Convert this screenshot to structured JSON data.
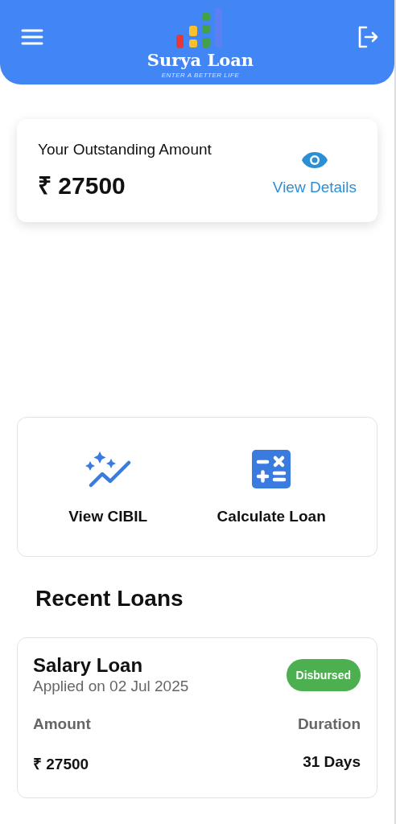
{
  "header": {
    "brand": "Surya Loan",
    "tagline": "ENTER A BETTER LIFE"
  },
  "outstanding": {
    "label": "Your Outstanding Amount",
    "amount": "₹ 27500",
    "link": "View Details"
  },
  "actions": [
    {
      "kind": "cibil",
      "label": "View CIBIL"
    },
    {
      "kind": "calculator",
      "label": "Calculate Loan"
    }
  ],
  "recent_loans": {
    "title": "Recent Loans",
    "loans": [
      {
        "name": "Salary Loan",
        "applied": "Applied on 02 Jul 2025",
        "status": "Disbursed",
        "amount_label": "Amount",
        "amount": "₹ 27500",
        "duration_label": "Duration",
        "duration": "31 Days"
      }
    ]
  }
}
